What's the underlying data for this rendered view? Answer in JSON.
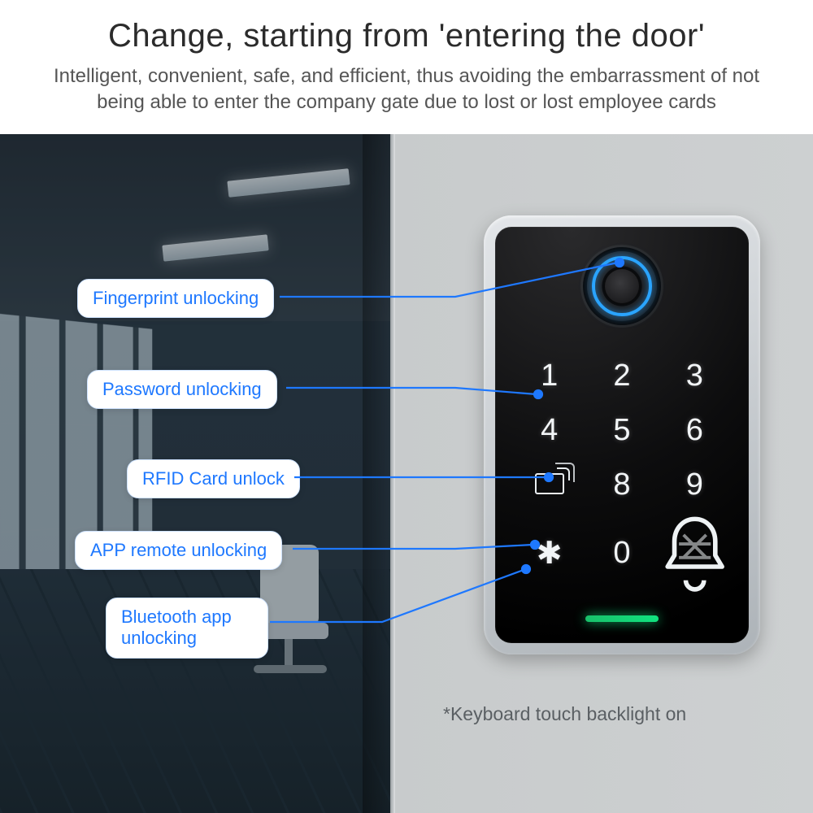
{
  "title": "Change, starting from 'entering the door'",
  "subtitle": "Intelligent, convenient, safe, and efficient, thus avoiding the embarrassment of not being able to enter the company gate due to lost or lost employee cards",
  "caption": "*Keyboard touch backlight on",
  "callouts": {
    "fingerprint": "Fingerprint unlocking",
    "password": "Password unlocking",
    "rfid": "RFID Card unlock",
    "app": "APP remote unlocking",
    "bluetooth": "Bluetooth app unlocking"
  },
  "keypad": {
    "k1": "1",
    "k2": "2",
    "k3": "3",
    "k4": "4",
    "k5": "5",
    "k6": "6",
    "k8": "8",
    "k9": "9",
    "star": "✱",
    "k0": "0"
  },
  "colors": {
    "link_blue": "#1e78ff",
    "ring_blue": "#2aa4ff",
    "led_green": "#11e27f"
  }
}
